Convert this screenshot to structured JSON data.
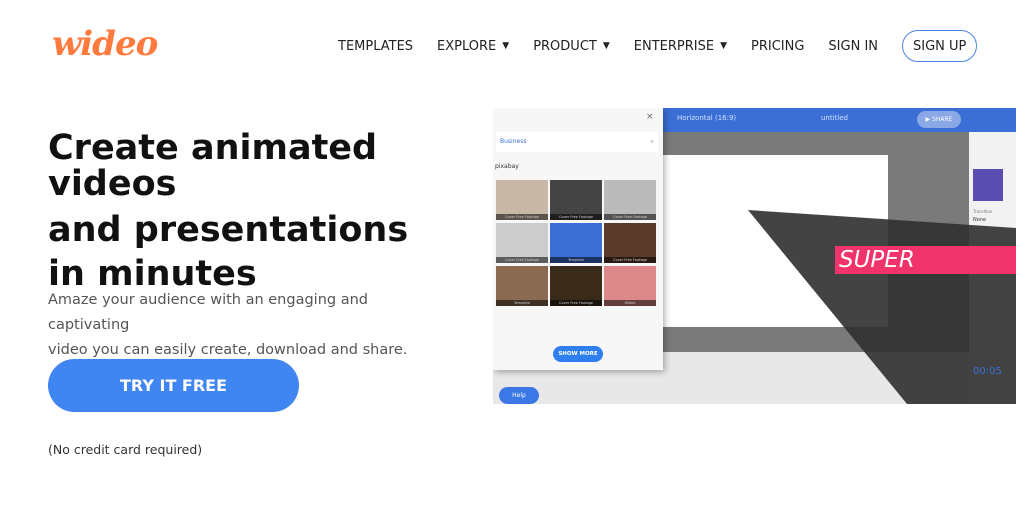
{
  "logo": "wideo",
  "nav": {
    "templates": "TEMPLATES",
    "explore": "EXPLORE",
    "product": "PRODUCT",
    "enterprise": "ENTERPRISE",
    "pricing": "PRICING",
    "sign_in": "SIGN IN",
    "sign_up": "SIGN UP",
    "chevron": "⌄"
  },
  "hero": {
    "line1": "Create animated",
    "line2": "videos",
    "line3": "and presentations",
    "line4": "in minutes"
  },
  "subtitle": {
    "line1": "Amaze your audience with an engaging and captivating",
    "line2": "video you can easily create, download and share."
  },
  "cta": "TRY IT FREE",
  "note": "(No credit card required)",
  "demo": {
    "format": "Horizontal (16:9)",
    "title": "untitled",
    "share": "▶ SHARE",
    "search": "Business",
    "provider": "pixabay",
    "super": "SUPER",
    "show_more": "SHOW MORE",
    "help": "Help",
    "transition": "Transition",
    "none": "None",
    "time": "00:05",
    "thumbs": [
      "Cover Free Footage",
      "Cover Free Footage",
      "Cover Free Footage",
      "Cover Free Footage",
      "Template",
      "Cover Free Footage",
      "Template",
      "Cover Free Footage",
      "Wideo"
    ]
  }
}
